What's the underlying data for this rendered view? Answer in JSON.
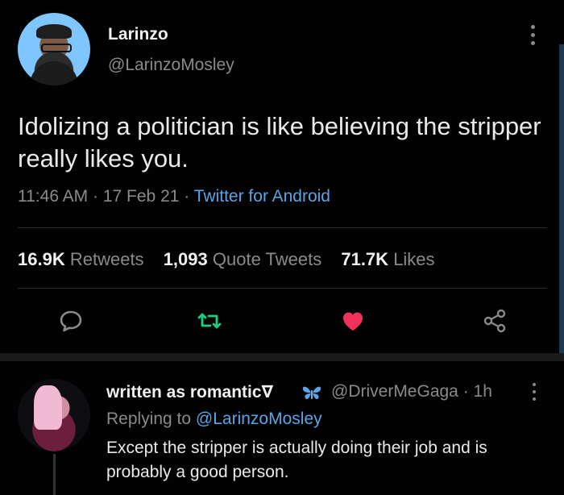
{
  "tweet": {
    "author_name": "Larinzo",
    "author_handle": "@LarinzoMosley",
    "text": "Idolizing a politician is like believing the stripper really likes you.",
    "time": "11:46 AM",
    "date": "17 Feb 21",
    "separator": "·",
    "source": "Twitter for Android"
  },
  "stats": {
    "retweets_count": "16.9K",
    "retweets_label": "Retweets",
    "quotes_count": "1,093",
    "quotes_label": "Quote Tweets",
    "likes_count": "71.7K",
    "likes_label": "Likes"
  },
  "actions": {
    "comment_icon": "comment-icon",
    "retweet_icon": "retweet-icon",
    "like_icon": "heart-icon",
    "share_icon": "share-icon"
  },
  "reply": {
    "author_name": "written as romantic∇",
    "emoji_icon": "butterfly-icon",
    "author_handle": "@DriverMeGaga",
    "age": "· 1h",
    "replying_prefix": "Replying to",
    "replying_to": "@LarinzoMosley",
    "text": "Except the stripper is actually doing their job and is probably a good person."
  },
  "colors": {
    "background": "#020202",
    "link": "#5aa4e8",
    "retweet": "#19cf86",
    "like": "#f0325a",
    "muted": "#8a8a8a"
  }
}
